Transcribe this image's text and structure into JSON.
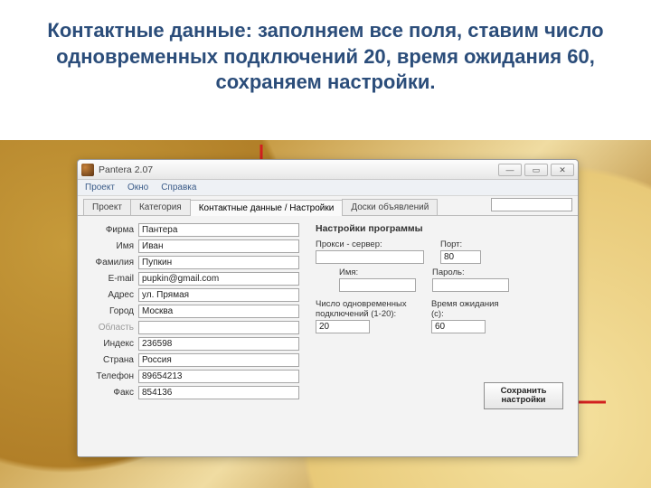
{
  "slide": {
    "title": "Контактные данные: заполняем все поля, ставим число одновременных подключений 20, время ожидания 60, сохраняем настройки."
  },
  "window": {
    "title": "Pantera 2.07",
    "menu": {
      "project": "Проект",
      "window": "Окно",
      "help": "Справка"
    },
    "tabs": {
      "project": "Проект",
      "category": "Категория",
      "contacts": "Контактные данные / Настройки",
      "boards": "Доски объявлений"
    }
  },
  "form": {
    "labels": {
      "company": "Фирма",
      "name": "Имя",
      "surname": "Фамилия",
      "email": "E-mail",
      "address": "Адрес",
      "city": "Город",
      "region": "Область",
      "index": "Индекс",
      "country": "Страна",
      "phone": "Телефон",
      "fax": "Факс"
    },
    "values": {
      "company": "Пантера",
      "name": "Иван",
      "surname": "Пупкин",
      "email": "pupkin@gmail.com",
      "address": "ул. Прямая",
      "city": "Москва",
      "region": "",
      "index": "236598",
      "country": "Россия",
      "phone": "89654213",
      "fax": "854136"
    }
  },
  "settings": {
    "title": "Настройки программы",
    "labels": {
      "proxy": "Прокси - сервер:",
      "port": "Порт:",
      "name": "Имя:",
      "password": "Пароль:",
      "connections": "Число одновременных подключений (1-20):",
      "timeout": "Время ожидания (с):"
    },
    "values": {
      "proxy": "",
      "port": "80",
      "name": "",
      "password": "",
      "connections": "20",
      "timeout": "60"
    },
    "save_label": "Сохранить настройки"
  }
}
